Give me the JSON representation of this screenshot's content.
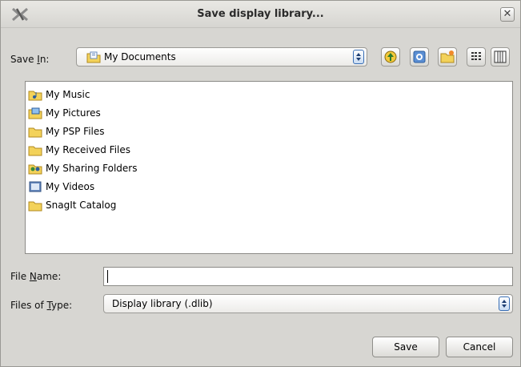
{
  "window": {
    "title": "Save display library...",
    "close_glyph": "✕"
  },
  "save_in": {
    "label_prefix": "Save ",
    "label_mnemonic": "I",
    "label_suffix": "n:",
    "value": "My Documents",
    "icon": "folder-documents-icon"
  },
  "toolbar": {
    "buttons": [
      "up-one-level-icon",
      "desktop-icon",
      "new-folder-icon",
      "list-view-icon",
      "details-view-icon"
    ]
  },
  "files": [
    {
      "label": "My Music",
      "icon": "music-folder-icon"
    },
    {
      "label": "My Pictures",
      "icon": "pictures-folder-icon"
    },
    {
      "label": "My PSP Files",
      "icon": "folder-icon"
    },
    {
      "label": "My Received Files",
      "icon": "folder-icon"
    },
    {
      "label": "My Sharing Folders",
      "icon": "sharing-folder-icon"
    },
    {
      "label": "My Videos",
      "icon": "videos-folder-icon"
    },
    {
      "label": "SnagIt Catalog",
      "icon": "folder-icon"
    }
  ],
  "file_name": {
    "label_prefix": "File ",
    "label_mnemonic": "N",
    "label_suffix": "ame:",
    "value": ""
  },
  "file_type": {
    "label_prefix": "Files of ",
    "label_mnemonic": "T",
    "label_suffix": "ype:",
    "value": "Display library (.dlib)"
  },
  "actions": {
    "save_label": "Save",
    "cancel_label": "Cancel"
  },
  "colors": {
    "folder_yellow": "#f3d25a",
    "accent_blue": "#3a6fb5",
    "dialog_bg": "#d7d6d2"
  }
}
